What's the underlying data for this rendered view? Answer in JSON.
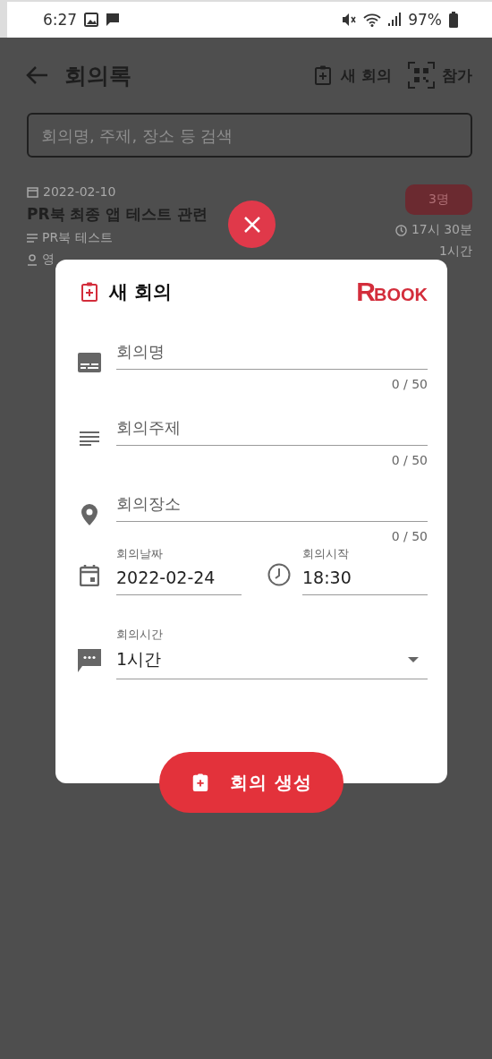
{
  "status_bar": {
    "time": "6:27",
    "battery": "97%"
  },
  "header": {
    "title": "회의록",
    "actions": [
      {
        "label": "새 회의"
      },
      {
        "label": "참가"
      }
    ]
  },
  "search": {
    "placeholder": "회의명, 주제, 장소 등 검색"
  },
  "meetings": [
    {
      "date": "2022-02-10",
      "title": "PR북 최종 앱 테스트 관련",
      "topic": "PR북 테스트",
      "place": "영",
      "attendees": "3명",
      "start": "17시 30분",
      "duration": "1시간"
    }
  ],
  "dialog": {
    "title": "새 회의",
    "logo": {
      "mark": "R",
      "name": "BOOK"
    },
    "fields": [
      {
        "placeholder": "회의명",
        "counter": "0 / 50"
      },
      {
        "placeholder": "회의주제",
        "counter": "0 / 50"
      },
      {
        "placeholder": "회의장소",
        "counter": "0 / 50"
      }
    ],
    "date": {
      "label": "회의날짜",
      "value": "2022-02-24"
    },
    "start": {
      "label": "회의시작",
      "value": "18:30"
    },
    "duration": {
      "label": "회의시간",
      "value": "1시간"
    },
    "create_button": {
      "label": "회의 생성"
    }
  }
}
